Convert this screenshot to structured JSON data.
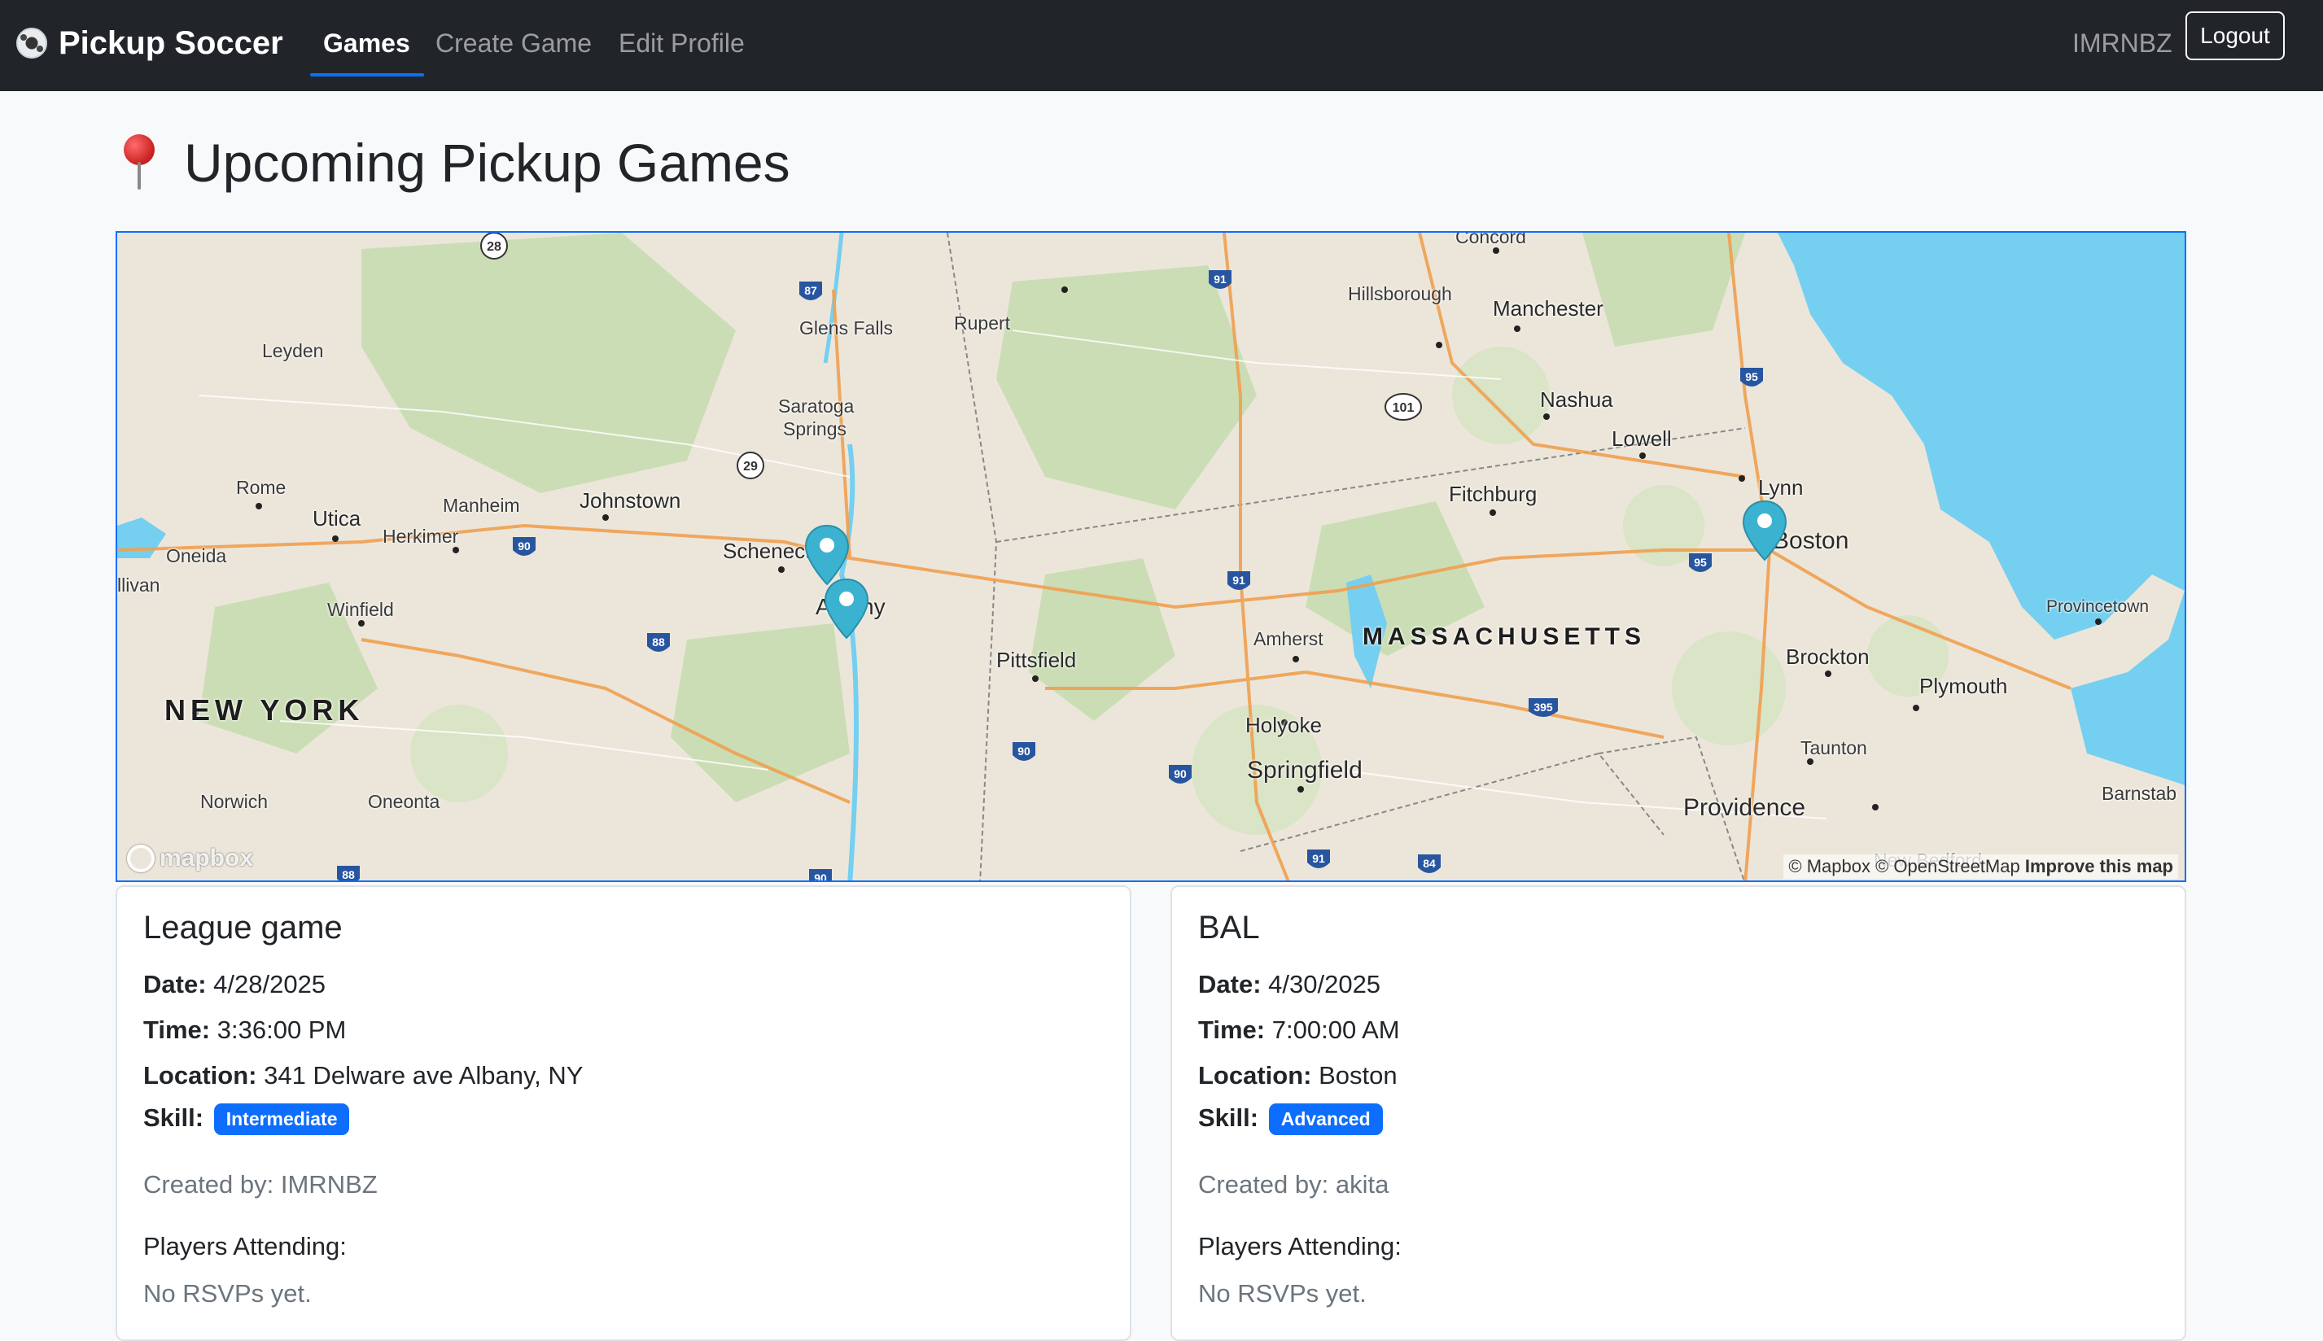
{
  "navbar": {
    "brand": "Pickup Soccer",
    "brand_icon": "soccer-ball-icon",
    "links": [
      {
        "label": "Games",
        "active": true
      },
      {
        "label": "Create Game",
        "active": false
      },
      {
        "label": "Edit Profile",
        "active": false
      }
    ],
    "username": "IMRNBZ",
    "logout_label": "Logout"
  },
  "page": {
    "title": "Upcoming Pickup Games",
    "title_icon": "pushpin-icon"
  },
  "map": {
    "states": [
      "NEW YORK",
      "MASSACHUSETTS"
    ],
    "cities": [
      "Concord",
      "Glens Falls",
      "Rupert",
      "Hillsborough",
      "Manchester",
      "Leyden",
      "Nashua",
      "Saratoga",
      "Springs",
      "Lowell",
      "Rome",
      "Utica",
      "Manheim",
      "Johnstown",
      "Fitchburg",
      "Lynn",
      "Herkimer",
      "Oneida",
      "Schenectady",
      "Boston",
      "llivan",
      "Winfield",
      "Albany",
      "Provincetown",
      "Pittsfield",
      "Amherst",
      "Brockton",
      "Plymouth",
      "Holyoke",
      "Taunton",
      "Springfield",
      "Norwich",
      "Oneonta",
      "Providence",
      "Barnstab",
      "New Bedford"
    ],
    "highways": [
      "28",
      "87",
      "91",
      "101",
      "95",
      "29",
      "90",
      "95",
      "91",
      "88",
      "395",
      "90",
      "90",
      "91",
      "84",
      "88",
      "90"
    ],
    "logo_text": "mapbox",
    "attribution": "© Mapbox © OpenStreetMap",
    "improve_link": "Improve this map",
    "markers": [
      {
        "name": "Schenectady"
      },
      {
        "name": "Albany"
      },
      {
        "name": "Boston"
      }
    ],
    "colors": {
      "water": "#75cff0",
      "land": "#ece6da",
      "forest": "#c8dcb0",
      "highway": "#f0a050",
      "accent": "#0d6efd",
      "marker": "#3bb2d0"
    }
  },
  "games": [
    {
      "title": "League game",
      "date_label": "Date:",
      "date": "4/28/2025",
      "time_label": "Time:",
      "time": "3:36:00 PM",
      "location_label": "Location:",
      "location": "341 Delware ave Albany, NY",
      "skill_label": "Skill:",
      "skill": "Intermediate",
      "created_by": "Created by: IMRNBZ",
      "players_label": "Players Attending:",
      "rsvp": "No RSVPs yet."
    },
    {
      "title": "BAL",
      "date_label": "Date:",
      "date": "4/30/2025",
      "time_label": "Time:",
      "time": "7:00:00 AM",
      "location_label": "Location:",
      "location": "Boston",
      "skill_label": "Skill:",
      "skill": "Advanced",
      "created_by": "Created by: akita",
      "players_label": "Players Attending:",
      "rsvp": "No RSVPs yet."
    }
  ]
}
